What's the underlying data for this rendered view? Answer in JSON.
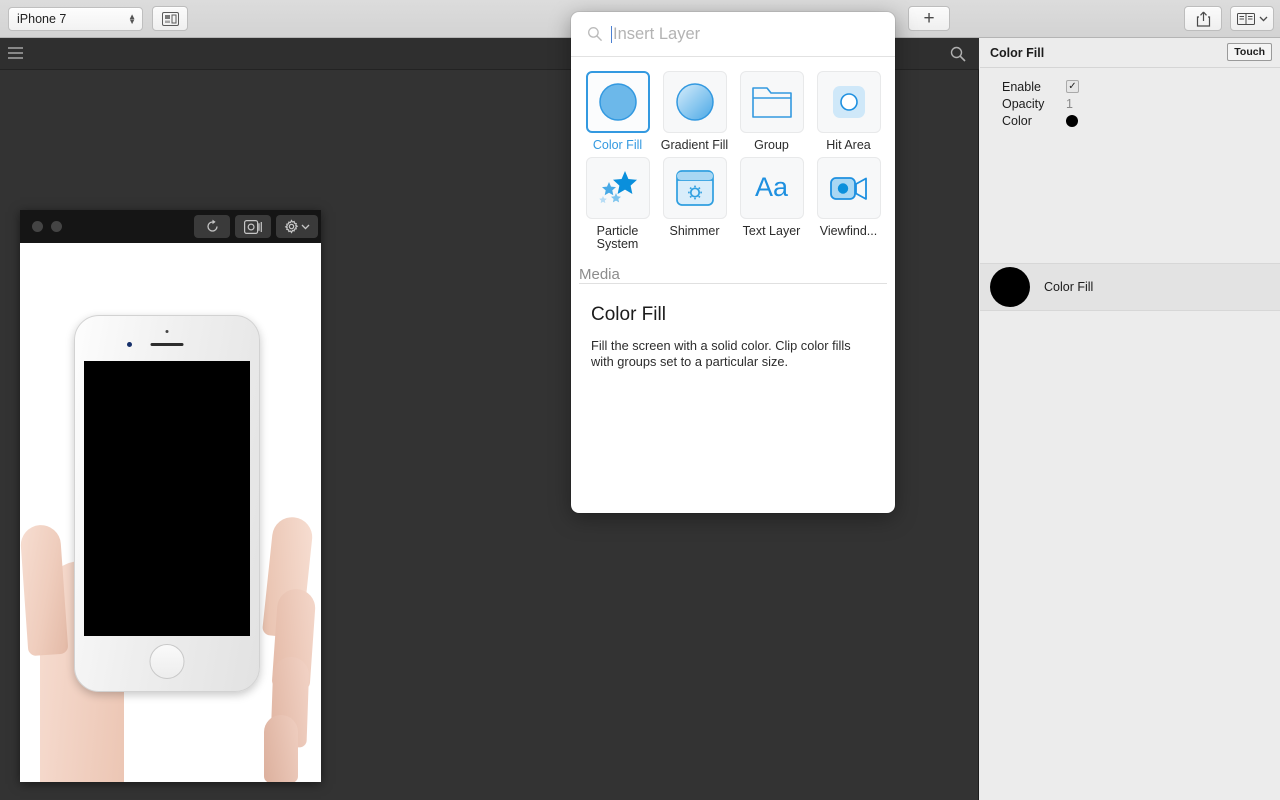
{
  "toolbar": {
    "device": "iPhone 7",
    "layout_icon": "layout-icon",
    "add_label": "+",
    "share_icon": "share-icon",
    "book_icon": "book-icon",
    "chevron_icon": "chevron-down-icon"
  },
  "appbar": {
    "menu_icon": "hamburger-icon",
    "search_icon": "search-icon"
  },
  "preview": {
    "reload_icon": "reload-icon",
    "record_icon": "record-icon",
    "gear_icon": "gear-icon",
    "chevron_icon": "chevron-down-icon"
  },
  "popup": {
    "search": {
      "placeholder": "Insert Layer",
      "icon": "search-icon"
    },
    "tiles": [
      {
        "label": "Color Fill",
        "icon": "circle-filled-icon",
        "selected": true
      },
      {
        "label": "Gradient Fill",
        "icon": "circle-gradient-icon",
        "selected": false
      },
      {
        "label": "Group",
        "icon": "folder-icon",
        "selected": false
      },
      {
        "label": "Hit Area",
        "icon": "hit-area-icon",
        "selected": false
      },
      {
        "label": "Particle System",
        "icon": "stars-icon",
        "selected": false
      },
      {
        "label": "Shimmer",
        "icon": "shimmer-icon",
        "selected": false
      },
      {
        "label": "Text Layer",
        "icon": "text-aa-icon",
        "selected": false
      },
      {
        "label": "Viewfind...",
        "icon": "video-camera-icon",
        "selected": false
      }
    ],
    "section_label": "Media",
    "detail": {
      "title": "Color Fill",
      "description": "Fill the screen with a solid color. Clip color fills with groups set to a particular size."
    }
  },
  "inspector": {
    "title": "Color Fill",
    "touch_label": "Touch",
    "properties": [
      {
        "name": "Enable",
        "type": "checkbox",
        "value": "✓"
      },
      {
        "name": "Opacity",
        "type": "text",
        "value": "1"
      },
      {
        "name": "Color",
        "type": "swatch",
        "value": "#000000"
      }
    ],
    "layers": [
      {
        "name": "Color Fill",
        "color": "#000000"
      }
    ]
  },
  "colors": {
    "accent": "#3399e0",
    "canvas": "#333333",
    "appbar": "#2f2f2f",
    "inspector_bg": "#ececec"
  }
}
